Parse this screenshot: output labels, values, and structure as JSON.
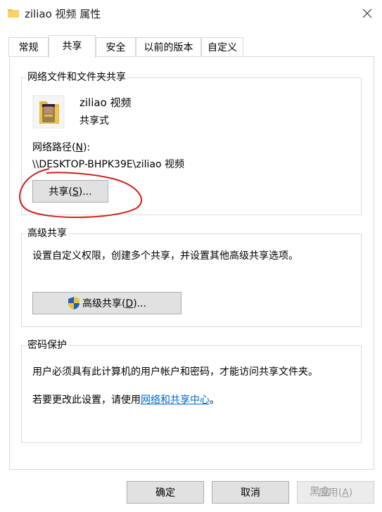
{
  "window": {
    "title": "ziliao 视频 属性",
    "icon": "folder-icon",
    "close_icon": "close-icon"
  },
  "tabs": [
    {
      "label": "常规",
      "active": false
    },
    {
      "label": "共享",
      "active": true
    },
    {
      "label": "安全",
      "active": false
    },
    {
      "label": "以前的版本",
      "active": false
    },
    {
      "label": "自定义",
      "active": false
    }
  ],
  "network_sharing": {
    "group_title": "网络文件和文件夹共享",
    "folder_name": "ziliao 视频",
    "status": "共享式",
    "path_label_prefix": "网络路径(",
    "path_label_key": "N",
    "path_label_suffix": "):",
    "path_value": "\\\\DESKTOP-BHPK39E\\ziliao 视频",
    "share_button_prefix": "共享(",
    "share_button_key": "S",
    "share_button_suffix": ")..."
  },
  "advanced_sharing": {
    "group_title": "高级共享",
    "description": "设置自定义权限，创建多个共享，并设置其他高级共享选项。",
    "button_prefix": "高级共享(",
    "button_key": "D",
    "button_suffix": ")...",
    "button_icon": "uac-shield-icon"
  },
  "password_protection": {
    "group_title": "密码保护",
    "description": "用户必须具有此计算机的用户帐户和密码，才能访问共享文件夹。",
    "change_prefix": "若要更改此设置，请使用",
    "change_link": "网络和共享中心",
    "change_suffix": "。"
  },
  "dialog_buttons": {
    "ok": "确定",
    "cancel": "取消",
    "apply_prefix": "应用(",
    "apply_key": "A",
    "apply_suffix": ")"
  },
  "watermark": "黑盒",
  "colors": {
    "annotation_circle": "#d0201a",
    "link": "#0066cc",
    "shield_blue": "#1f5fbf",
    "shield_yellow": "#f2c230"
  }
}
